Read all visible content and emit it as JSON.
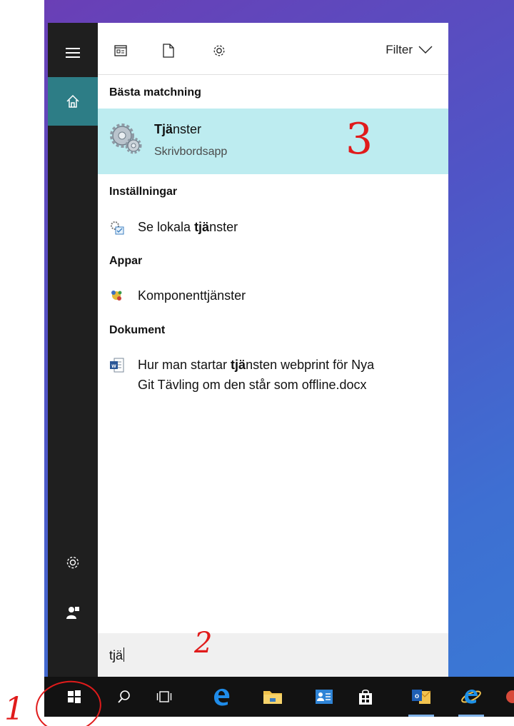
{
  "toolbar": {
    "icons": [
      "apps-icon",
      "document-icon",
      "gear-icon"
    ],
    "filter_label": "Filter"
  },
  "sections": {
    "best_match": "Bästa matchning",
    "settings": "Inställningar",
    "apps": "Appar",
    "documents": "Dokument"
  },
  "best_match": {
    "title_bold": "Tj",
    "title_bold2": "ä",
    "title_rest": "nster",
    "subtitle": "Skrivbordsapp"
  },
  "settings_item": {
    "pre": "Se lokala ",
    "bold": "tjä",
    "post": "nster"
  },
  "app_item": {
    "label": "Komponenttjänster"
  },
  "doc_item": {
    "pre": "Hur man startar ",
    "bold": "tjä",
    "post": "nsten webprint för Nya",
    "line2": "Git Tävling om den står som offline.docx"
  },
  "search": {
    "query": "tjä"
  },
  "annotations": {
    "a1": "1",
    "a2": "2",
    "a3": "3"
  },
  "colors": {
    "accent": "#2d7d86",
    "best_bg": "#bdecf0",
    "annotation": "#e01b1b"
  }
}
